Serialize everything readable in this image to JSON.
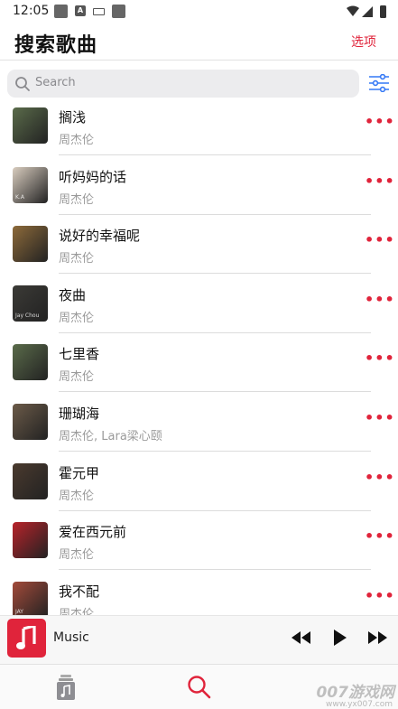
{
  "status_bar": {
    "time": "12:05",
    "badge_letter": "A"
  },
  "header": {
    "title": "搜索歌曲",
    "options_label": "选项"
  },
  "search": {
    "placeholder": "Search"
  },
  "songs": [
    {
      "title": "搁浅",
      "artist": "周杰伦",
      "cover_color": "#5a6b4a"
    },
    {
      "title": "听妈妈的话",
      "artist": "周杰伦",
      "cover_color": "#d9cdbf",
      "cover_text": "K.A"
    },
    {
      "title": "说好的幸福呢",
      "artist": "周杰伦",
      "cover_color": "#8d6a3a"
    },
    {
      "title": "夜曲",
      "artist": "周杰伦",
      "cover_color": "#3b3a36",
      "cover_text": "Jay Chou"
    },
    {
      "title": "七里香",
      "artist": "周杰伦",
      "cover_color": "#5a6b4a"
    },
    {
      "title": "珊瑚海",
      "artist": "周杰伦, Lara梁心颐",
      "cover_color": "#6b5a48"
    },
    {
      "title": "霍元甲",
      "artist": "周杰伦",
      "cover_color": "#4a3a2e"
    },
    {
      "title": "爱在西元前",
      "artist": "周杰伦",
      "cover_color": "#b8232a"
    },
    {
      "title": "我不配",
      "artist": "周杰伦",
      "cover_color": "#a34a3a",
      "cover_text": "JAY"
    }
  ],
  "more_glyph": "•••",
  "player": {
    "label": "Music"
  },
  "watermark": {
    "main": "007游戏网",
    "sub": "www.yx007.com"
  },
  "colors": {
    "accent": "#e0243b",
    "secondary_text": "#9a9a9a",
    "search_bg": "#ececee"
  }
}
